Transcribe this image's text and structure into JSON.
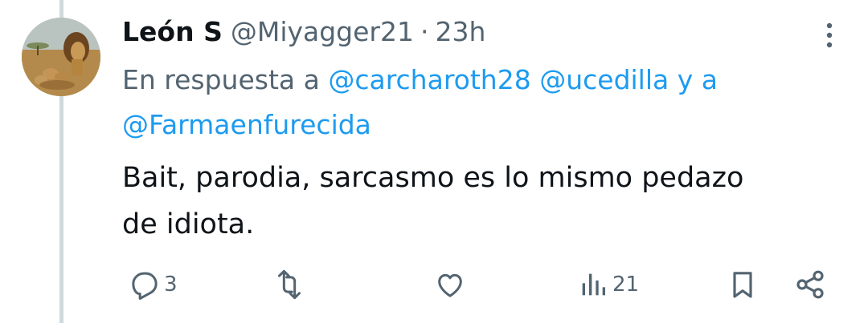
{
  "author": {
    "display_name": "León S",
    "handle": "@Miyagger21",
    "separator": "·",
    "time": "23h"
  },
  "reply_to": {
    "prefix": "En respuesta a",
    "mention1": "@carcharoth28",
    "mention2": "@ucedilla",
    "joiner": "y a",
    "mention3": "@Farmaenfurecida"
  },
  "tweet": {
    "line1": "Bait, parodia, sarcasmo es lo mismo pedazo",
    "line2": "de idiota."
  },
  "actions": {
    "reply_count": "3",
    "retweet_count": "",
    "like_count": "",
    "views_count": "21"
  },
  "colors": {
    "text": "#0f1419",
    "secondary": "#536471",
    "link": "#1d9bf0",
    "thread_line": "#cfd9de"
  },
  "icons": [
    "more-vertical-icon",
    "reply-icon",
    "retweet-icon",
    "like-icon",
    "views-icon",
    "bookmark-icon",
    "share-icon"
  ]
}
